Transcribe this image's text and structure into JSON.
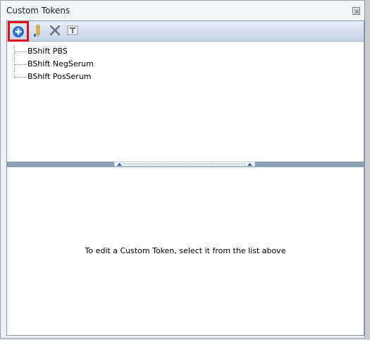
{
  "window": {
    "title": "Custom Tokens"
  },
  "toolbar": {
    "buttons": [
      {
        "name": "add",
        "icon": "plus-circle-icon"
      },
      {
        "name": "rename",
        "icon": "pencil-icon"
      },
      {
        "name": "delete",
        "icon": "x-icon"
      },
      {
        "name": "text",
        "icon": "text-box-icon"
      }
    ]
  },
  "tokens": [
    {
      "label": "BShift PBS"
    },
    {
      "label": "BShift NegSerum"
    },
    {
      "label": "BShift PosSerum"
    }
  ],
  "editor": {
    "hint": "To edit a Custom Token, select it from the list above"
  },
  "colors": {
    "toolbar_gradient_top": "#e6eef8",
    "toolbar_gradient_bottom": "#c6d4e6",
    "splitter": "#8ea0b6",
    "highlight": "#e0101e",
    "add_icon": "#2b6fd6"
  }
}
